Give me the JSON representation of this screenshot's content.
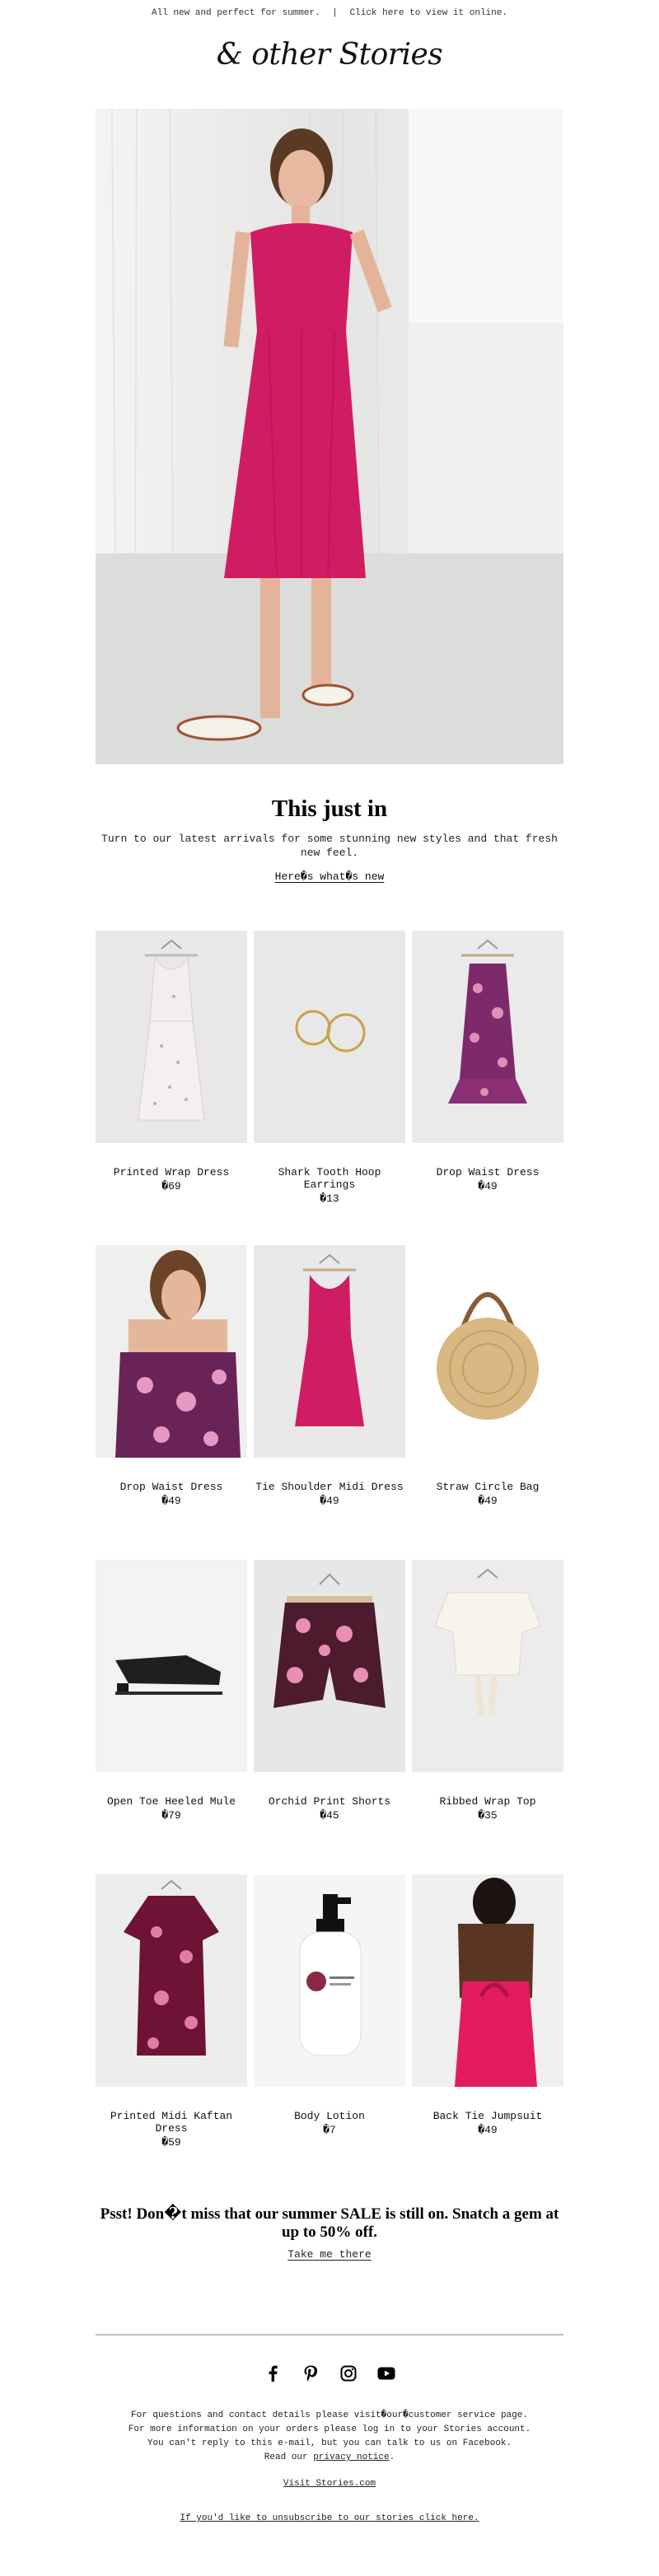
{
  "preheader": {
    "text": "All new and perfect for summer.",
    "separator": "|",
    "view_online": "Click here to view it online."
  },
  "brand": {
    "logo_text": "& other Stories"
  },
  "hero": {
    "image": "model-in-pink-midi-dress-photo"
  },
  "intro": {
    "headline": "This just in",
    "body": "Turn to our latest arrivals for some stunning new styles and that fresh new feel.",
    "cta": "Here�s what�s new"
  },
  "products": [
    {
      "name": "Printed Wrap Dress",
      "price": "�69",
      "image": "white-printed-wrap-dress"
    },
    {
      "name": "Shark Tooth Hoop Earrings",
      "price": "�13",
      "image": "gold-hoop-earrings"
    },
    {
      "name": "Drop Waist Dress",
      "price": "�49",
      "image": "purple-floral-drop-waist-dress"
    },
    {
      "name": "Drop Waist Dress",
      "price": "�49",
      "image": "model-floral-top"
    },
    {
      "name": "Tie Shoulder Midi Dress",
      "price": "�49",
      "image": "pink-tie-shoulder-dress"
    },
    {
      "name": "Straw Circle Bag",
      "price": "�49",
      "image": "straw-circle-bag"
    },
    {
      "name": "Open Toe Heeled Mule",
      "price": "�79",
      "image": "black-heeled-mule"
    },
    {
      "name": "Orchid Print Shorts",
      "price": "�45",
      "image": "orchid-print-shorts"
    },
    {
      "name": "Ribbed Wrap Top",
      "price": "�35",
      "image": "white-ribbed-wrap-top"
    },
    {
      "name": "Printed Midi Kaftan Dress",
      "price": "�59",
      "image": "burgundy-kaftan-dress"
    },
    {
      "name": "Body Lotion",
      "price": "�7",
      "image": "body-lotion-bottle"
    },
    {
      "name": "Back Tie Jumpsuit",
      "price": "�49",
      "image": "model-pink-jumpsuit-back"
    }
  ],
  "sale": {
    "text": "Psst! Don�t miss that our summer SALE is still on. Snatch a gem at up to 50% off.",
    "cta": "Take me there"
  },
  "social": {
    "icons": [
      "facebook-icon",
      "pinterest-icon",
      "instagram-icon",
      "youtube-icon"
    ]
  },
  "footer": {
    "line1": "For questions and contact details please visit�our�customer service page.",
    "line2": "For more information on your orders please log in to your Stories account.",
    "line3": "You can't reply to this e-mail, but you can talk to us on Facebook.",
    "line4_prefix": "Read our ",
    "line4_link": "privacy notice",
    "line4_suffix": ".",
    "visit": "Visit Stories.com",
    "unsubscribe": "If you'd like to unsubscribe to our stories click here."
  },
  "colors": {
    "accent_pink": "#d01c63",
    "burgundy": "#6e1236",
    "text": "#222222"
  }
}
